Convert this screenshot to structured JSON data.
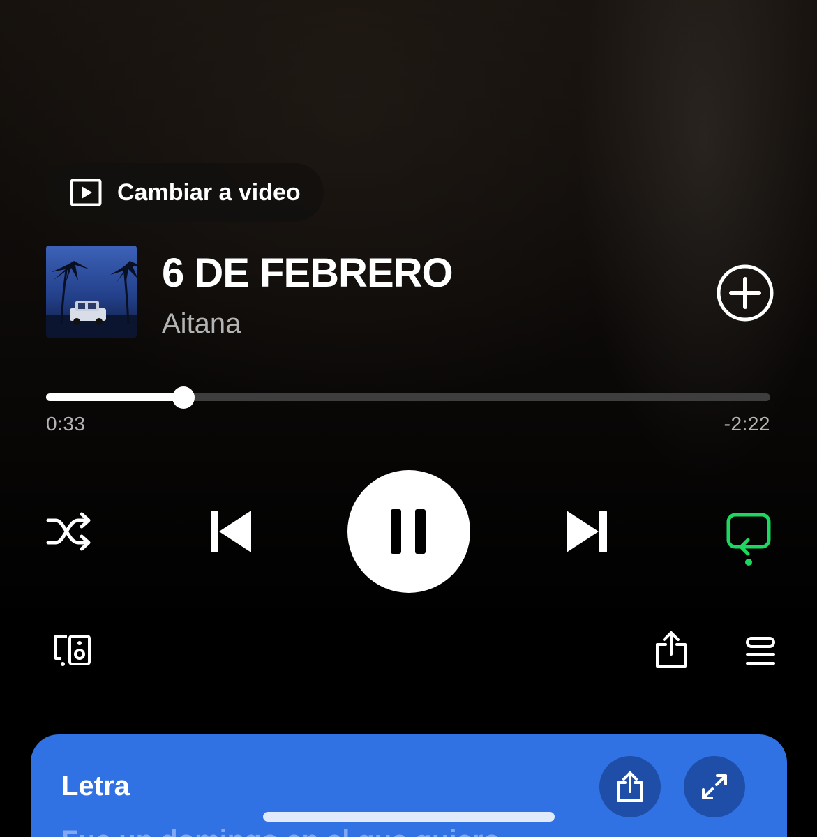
{
  "video_toggle": {
    "label": "Cambiar a video",
    "icon": "play-square-icon"
  },
  "track": {
    "title": "6 DE FEBRERO",
    "artist": "Aitana"
  },
  "progress": {
    "elapsed": "0:33",
    "remaining": "-2:22",
    "fraction": 0.19
  },
  "controls": {
    "shuffle_icon": "shuffle-icon",
    "previous_icon": "skip-previous-icon",
    "pause_icon": "pause-icon",
    "next_icon": "skip-next-icon",
    "repeat_icon": "repeat-icon",
    "repeat_active_color": "#1ed760"
  },
  "secondary": {
    "devices_icon": "connect-device-icon",
    "share_icon": "share-icon",
    "queue_icon": "queue-icon"
  },
  "lyrics": {
    "label": "Letra",
    "preview": "Fue un domingo en el que quiero",
    "share_icon": "share-icon",
    "expand_icon": "expand-icon",
    "background_color": "#3071e3"
  },
  "colors": {
    "background": "#000000",
    "secondary_text": "#b3b3b3",
    "accent": "#1ed760"
  }
}
